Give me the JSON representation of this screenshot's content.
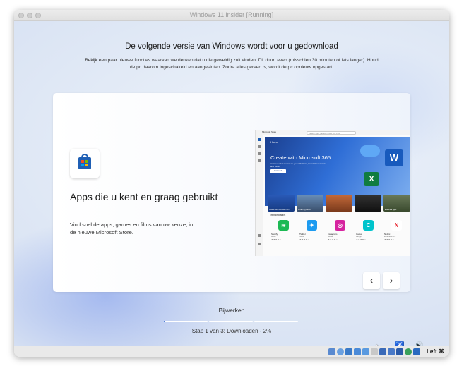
{
  "window": {
    "title": "Windows 11 insider [Running]"
  },
  "setup": {
    "heading": "De volgende versie van Windows wordt voor u gedownload",
    "subtitle": "Bekijk een paar nieuwe functies waarvan we denken dat u die geweldig zult vinden. Dit duurt even (misschien 30 minuten of iets langer). Houd de pc daarom ingeschakeld en aangesloten. Zodra alles gereed is, wordt de pc opnieuw opgestart."
  },
  "feature_card": {
    "title": "Apps die u kent en graag gebruikt",
    "description": "Vind snel de apps, games en films van uw keuze, in de nieuwe Microsoft Store.",
    "icon": "microsoft-store-icon",
    "prev_label": "‹",
    "next_label": "›"
  },
  "store_preview": {
    "app_name": "Microsoft Store",
    "search_placeholder": "Search apps, games, movies and more",
    "home_label": "Home",
    "hero_title": "Create with Microsoft 365",
    "hero_subtitle": "Achieve what matters to you with Word, Excel, Powerpoint and more.",
    "hero_button": "Get Details",
    "tiles": [
      "Create with Microsoft 365",
      "Amazing places",
      "",
      "",
      "Essential apps"
    ],
    "trending_label": "Trending apps",
    "trending_apps": [
      {
        "name": "Spotify",
        "category": "Music",
        "color": "#1db954",
        "glyph": "≋"
      },
      {
        "name": "Twitter",
        "category": "Social",
        "color": "#1d9bf0",
        "glyph": "✦"
      },
      {
        "name": "Instagram",
        "category": "Social",
        "color": "#d6249f",
        "glyph": "◎"
      },
      {
        "name": "Canva",
        "category": "Design",
        "color": "#00c4cc",
        "glyph": "C"
      },
      {
        "name": "Netflix",
        "category": "Entertainment",
        "color": "#ffffff",
        "glyph": "N"
      }
    ],
    "stars": "★★★★☆"
  },
  "progress": {
    "label": "Bijwerken",
    "status": "Stap 1 van 3: Downloaden - 2%",
    "step1_fraction": 0.02,
    "step2_fraction": 0,
    "step3_fraction": 0,
    "accent": "#3b6fd0"
  },
  "tray": {
    "accessibility_icon": "accessibility-icon",
    "volume_icon": "volume-icon"
  },
  "vm_statusbar": {
    "host_key": "Left ⌘"
  }
}
